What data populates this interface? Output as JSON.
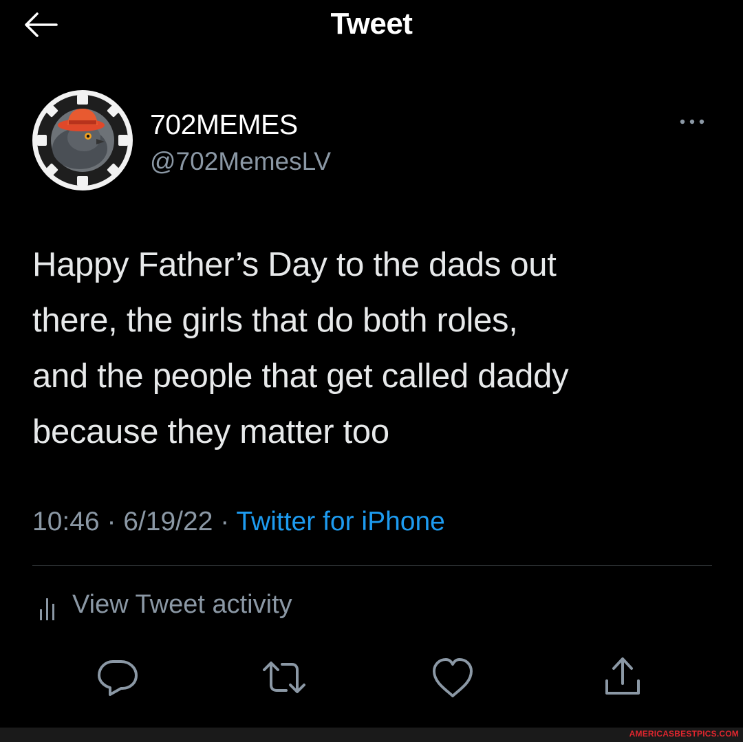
{
  "header": {
    "title": "Tweet",
    "back_icon": "arrow-left-icon"
  },
  "author": {
    "display_name": "702MEMES",
    "handle": "@702MemesLV",
    "avatar_icon": "poker-chip-pigeon-avatar",
    "more_icon": "more-dots-icon"
  },
  "tweet": {
    "text": "Happy Father’s Day to the dads out\nthere, the girls that do both roles,\nand the people that get called daddy\nbecause they matter too",
    "time": "10:46",
    "separator": " · ",
    "date": "6/19/22",
    "source": "Twitter for iPhone"
  },
  "activity": {
    "label": "View Tweet activity",
    "icon": "bar-chart-icon"
  },
  "actions": {
    "reply_icon": "reply-icon",
    "retweet_icon": "retweet-icon",
    "like_icon": "heart-icon",
    "share_icon": "share-icon"
  },
  "watermark": "AMERICASBESTPICS.COM",
  "colors": {
    "background": "#000000",
    "text": "#e7e9ea",
    "secondary": "#8b98a5",
    "link": "#1d9bf0",
    "divider": "#2f3336",
    "watermark": "#e0262e"
  }
}
